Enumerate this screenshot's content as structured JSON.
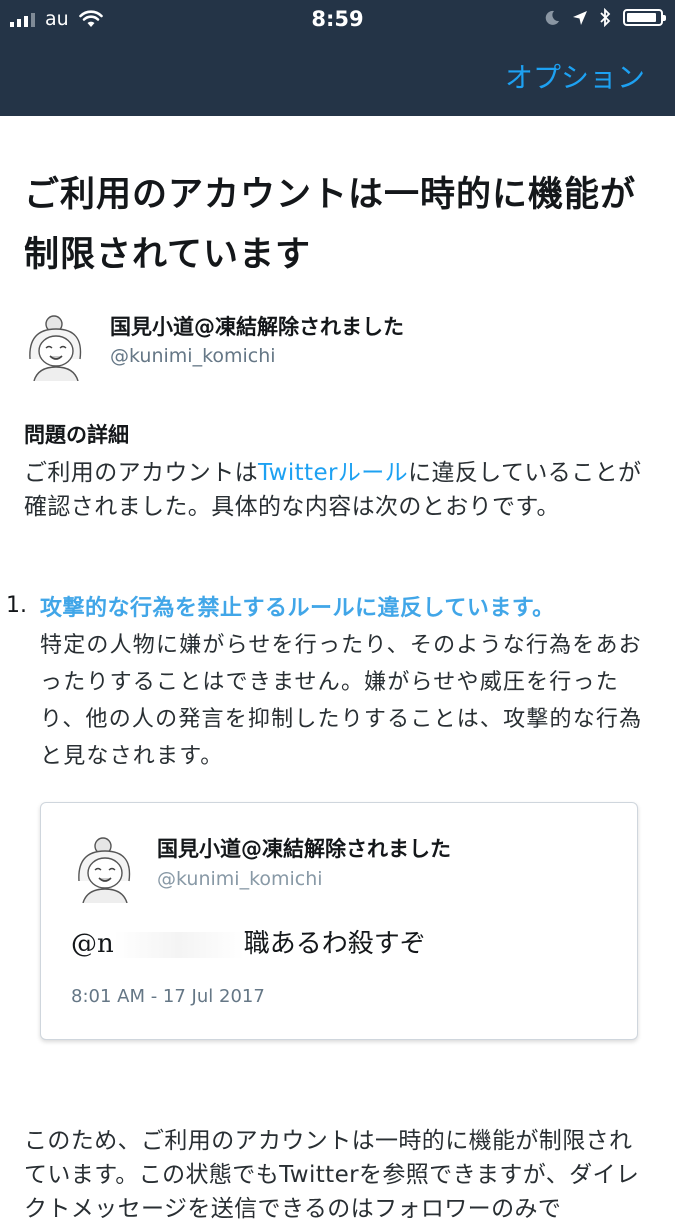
{
  "status_bar": {
    "carrier": "au",
    "time": "8:59",
    "battery_level": 0.9
  },
  "nav": {
    "options_label": "オプション"
  },
  "page": {
    "title": "ご利用のアカウントは一時的に機能が制限されています"
  },
  "account": {
    "display_name": "国見小道@凍結解除されました",
    "handle": "@kunimi_komichi"
  },
  "details": {
    "heading": "問題の詳細",
    "text_before": "ご利用のアカウントは",
    "rules_link": "Twitterルール",
    "text_after": "に違反していることが確認されました。具体的な内容は次のとおりです。"
  },
  "violations": [
    {
      "number": "1.",
      "title": "攻撃的な行為を禁止するルールに違反しています。",
      "description": "特定の人物に嫌がらせを行ったり、そのような行為をあおったりすることはできません。嫌がらせや威圧を行ったり、他の人の発言を抑制したりすることは、攻撃的な行為と見なされます。"
    }
  ],
  "tweet": {
    "display_name": "国見小道@凍結解除されました",
    "handle": "@kunimi_komichi",
    "text_prefix": "@n",
    "text_suffix": "職あるわ殺すぞ",
    "timestamp": "8:01 AM - 17 Jul 2017"
  },
  "footer": {
    "text": "このため、ご利用のアカウントは一時的に機能が制限されています。この状態でもTwitterを参照できますが、ダイレクトメッセージを送信できるのはフォロワーのみで"
  }
}
